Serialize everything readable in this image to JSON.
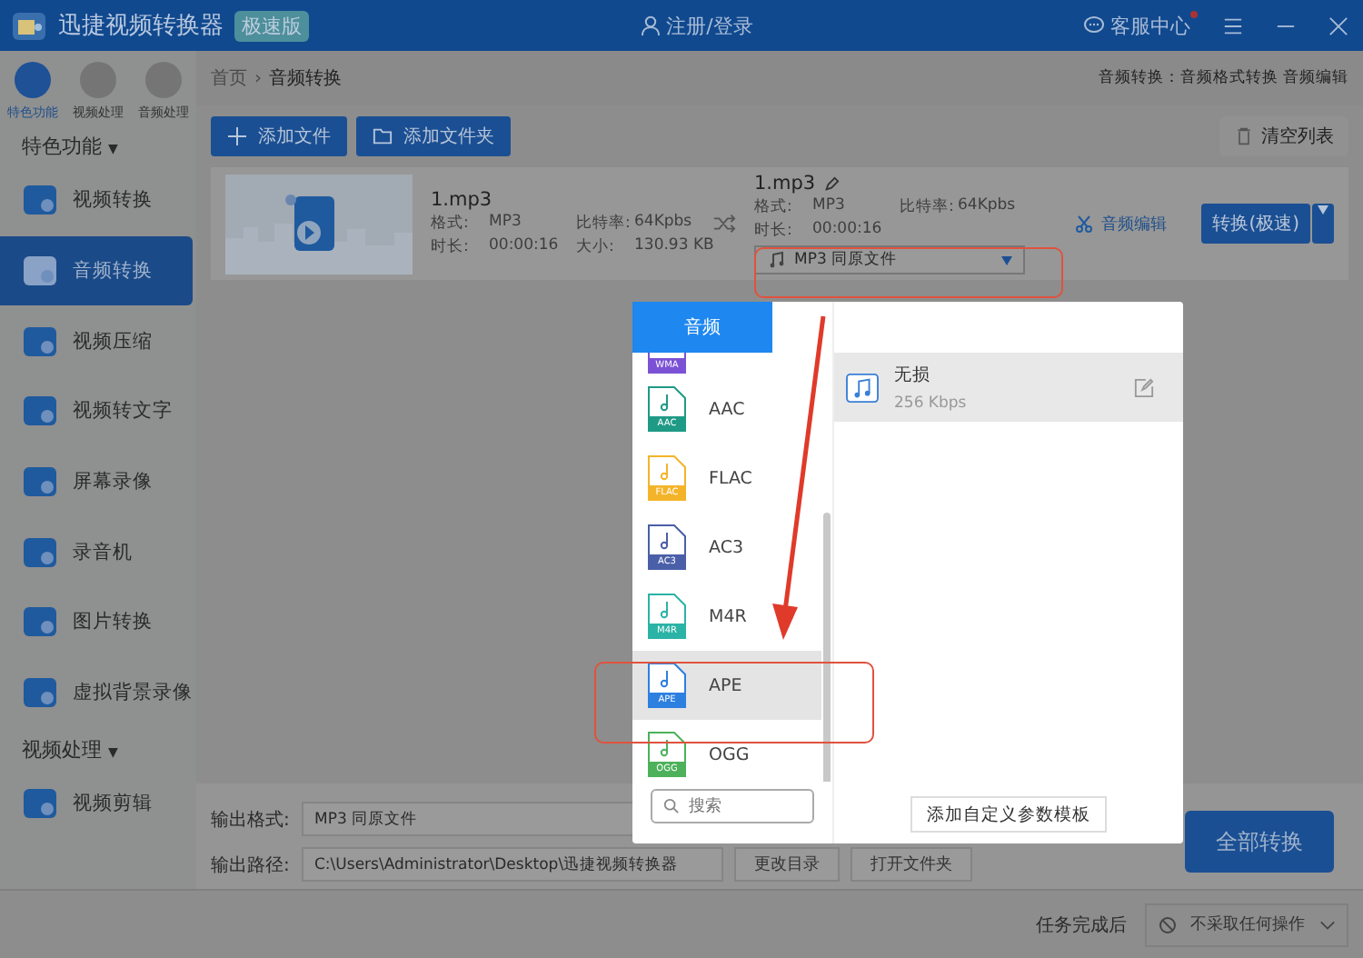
{
  "app": {
    "title": "迅捷视频转换器",
    "edition": "极速版",
    "login": "注册/登录",
    "support": "客服中心"
  },
  "sidebar": {
    "categories": [
      {
        "label": "特色功能",
        "selected": true
      },
      {
        "label": "视频处理",
        "selected": false
      },
      {
        "label": "音频处理",
        "selected": false
      }
    ],
    "section_title": "特色功能",
    "section_caret": "▼",
    "items": [
      {
        "label": "视频转换",
        "selected": false
      },
      {
        "label": "音频转换",
        "selected": true
      },
      {
        "label": "视频压缩",
        "selected": false
      },
      {
        "label": "视频转文字",
        "selected": false
      },
      {
        "label": "屏幕录像",
        "selected": false
      },
      {
        "label": "录音机",
        "selected": false
      },
      {
        "label": "图片转换",
        "selected": false
      },
      {
        "label": "虚拟背景录像",
        "selected": false
      }
    ],
    "section2_title": "视频处理",
    "section2_caret": "▼",
    "items2": [
      {
        "label": "视频剪辑",
        "selected": false
      }
    ]
  },
  "breadcrumb": {
    "home": "首页",
    "sep": "›",
    "current": "音频转换",
    "right": "音频转换：音频格式转换 音频编辑"
  },
  "toolbar": {
    "add_file": "添加文件",
    "add_folder": "添加文件夹",
    "clear": "清空列表"
  },
  "file": {
    "name": "1.mp3",
    "format_label": "格式:",
    "format": "MP3",
    "bitrate_label": "比特率:",
    "bitrate": "64Kpbs",
    "duration_label": "时长:",
    "duration": "00:00:16",
    "size_label": "大小:",
    "size": "130.93 KB",
    "out_name": "1.mp3",
    "out_format_label": "格式:",
    "out_format": "MP3",
    "out_bitrate_label": "比特率:",
    "out_bitrate": "64Kpbs",
    "out_duration_label": "时长:",
    "out_duration": "00:00:16",
    "out_select": "MP3  同原文件",
    "edit": "音频编辑",
    "convert": "转换(极速)"
  },
  "output": {
    "format_label": "输出格式:",
    "format": "MP3  同原文件",
    "path_label": "输出路径:",
    "path": "C:\\Users\\Administrator\\Desktop\\迅捷视频转换器",
    "change_dir": "更改目录",
    "open_folder": "打开文件夹",
    "convert_all": "全部转换"
  },
  "status_bar": {
    "label": "任务完成后",
    "action": "不采取任何操作"
  },
  "popup": {
    "tab": "音频",
    "partial_badge": {
      "badge": "WMA",
      "color": "#7b52d6"
    },
    "formats": [
      {
        "label": "AAC",
        "badge": "AAC",
        "color": "#1f9a86",
        "selected": false
      },
      {
        "label": "FLAC",
        "badge": "FLAC",
        "color": "#f4b42a",
        "selected": false
      },
      {
        "label": "AC3",
        "badge": "AC3",
        "color": "#4a5fa8",
        "selected": false
      },
      {
        "label": "M4R",
        "badge": "M4R",
        "color": "#2bb3a6",
        "selected": false
      },
      {
        "label": "APE",
        "badge": "APE",
        "color": "#2d7fe0",
        "selected": true
      },
      {
        "label": "OGG",
        "badge": "OGG",
        "color": "#4cb15a",
        "selected": false
      }
    ],
    "search_placeholder": "搜索",
    "preset": {
      "name": "无损",
      "detail": "256 Kbps",
      "selected": true
    },
    "add_template": "添加自定义参数模板"
  }
}
